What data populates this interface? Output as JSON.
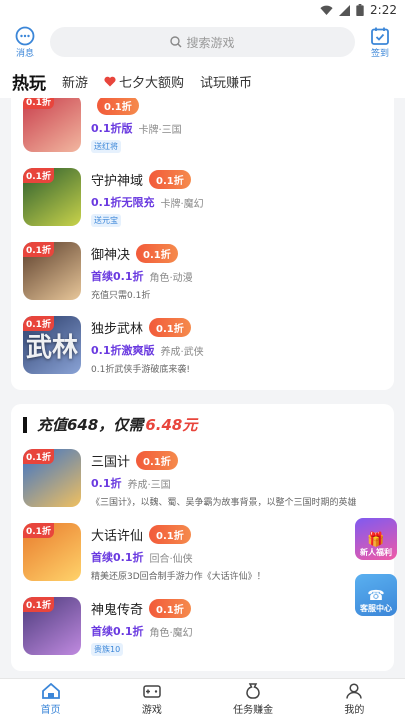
{
  "status": {
    "time": "2:22"
  },
  "topbar": {
    "message_label": "消息",
    "search_placeholder": "搜索游戏",
    "checkin_label": "签到"
  },
  "tabs": [
    {
      "label": "热玩",
      "active": true
    },
    {
      "label": "新游",
      "active": false
    },
    {
      "label": "七夕大额购",
      "active": false,
      "icon": "heart-icon"
    },
    {
      "label": "试玩赚币",
      "active": false
    }
  ],
  "card1": {
    "games": [
      {
        "name": "",
        "badge": "0.1折",
        "promo": "0.1折版",
        "category": "卡牌·三国",
        "tag": "送红将",
        "desc": "",
        "colors": [
          "#c73b4a",
          "#f2b7a0"
        ],
        "glyph": ""
      },
      {
        "name": "守护神域",
        "badge": "0.1折",
        "promo": "0.1折无限充",
        "category": "卡牌·魔幻",
        "tag": "送元宝",
        "desc": "",
        "colors": [
          "#2a5c2e",
          "#c9d34b"
        ],
        "glyph": ""
      },
      {
        "name": "御神决",
        "badge": "0.1折",
        "promo": "首续0.1折",
        "category": "角色·动漫",
        "tag": "",
        "desc": "充值只需0.1折",
        "colors": [
          "#5a3d2b",
          "#e8c79a"
        ],
        "glyph": ""
      },
      {
        "name": "独步武林",
        "badge": "0.1折",
        "promo": "0.1折激爽版",
        "category": "养成·武侠",
        "tag": "",
        "desc": "0.1折武侠手游破底来袭!",
        "colors": [
          "#2c3e6b",
          "#8aa3d6"
        ],
        "glyph": "武林"
      }
    ]
  },
  "card2": {
    "title_prefix": "充值648，仅需",
    "title_highlight": "6.48元",
    "games": [
      {
        "name": "三国计",
        "badge": "0.1折",
        "promo": "0.1折",
        "category": "养成·三国",
        "tag": "",
        "desc": "《三国计》，以魏、蜀、吴争霸为故事背景，以整个三国时期的英雄",
        "colors": [
          "#3a72c8",
          "#f0c060"
        ],
        "glyph": ""
      },
      {
        "name": "大话许仙",
        "badge": "0.1折",
        "promo": "首续0.1折",
        "category": "回合·仙侠",
        "tag": "",
        "desc": "精美还原3D回合制手游力作《大话许仙》！",
        "colors": [
          "#e87a2c",
          "#ffd36b"
        ],
        "glyph": ""
      },
      {
        "name": "神鬼传奇",
        "badge": "0.1折",
        "promo": "首续0.1折",
        "category": "角色·魔幻",
        "tag": "贵族10",
        "desc": "",
        "colors": [
          "#4a3a7a",
          "#c08ae0"
        ],
        "glyph": ""
      }
    ]
  },
  "floats": {
    "newbie": "新人福利",
    "service": "客服中心"
  },
  "bottomnav": [
    {
      "label": "首页",
      "icon": "home-icon",
      "active": true
    },
    {
      "label": "游戏",
      "icon": "gamepad-icon",
      "active": false
    },
    {
      "label": "任务赚金",
      "icon": "money-bag-icon",
      "active": false
    },
    {
      "label": "我的",
      "icon": "user-icon",
      "active": false
    }
  ],
  "colors": {
    "accent": "#3b86d8",
    "badge": "#f25a3a",
    "promo": "#6a3ae0",
    "highlight": "#e8453c"
  }
}
